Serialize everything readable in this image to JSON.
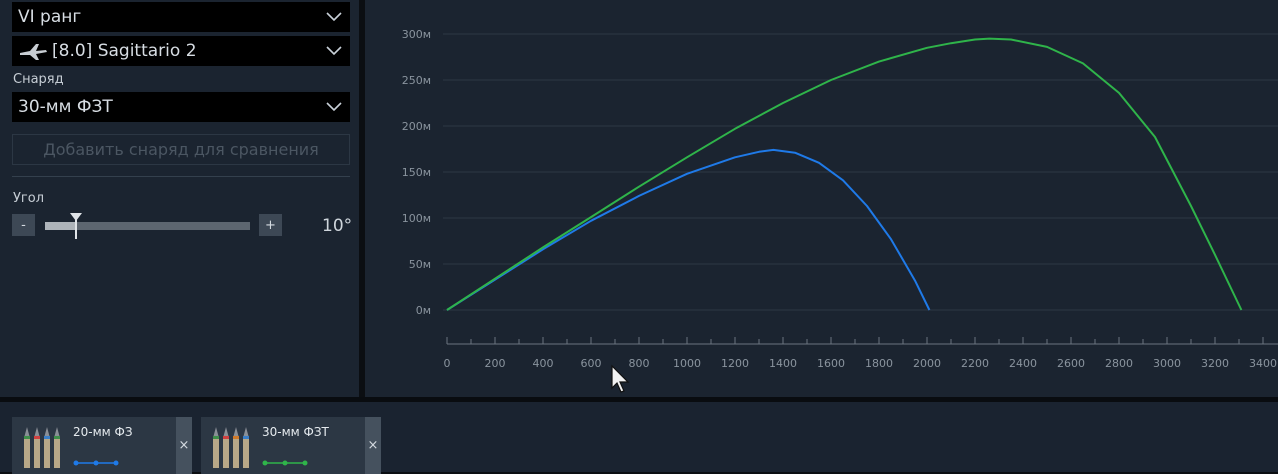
{
  "left": {
    "rank_select": "VI ранг",
    "vehicle_select": "[8.0] Sagittario 2",
    "shell_label": "Снаряд",
    "shell_select": "30-мм ФЗТ",
    "add_shell_button": "Добавить снаряд для сравнения",
    "angle_label": "Угол",
    "minus": "-",
    "plus": "+",
    "angle_value": "10°",
    "angle_slider_fraction": 0.15
  },
  "chart_data": {
    "type": "line",
    "title": "",
    "xlabel": "",
    "ylabel": "",
    "xlim": [
      0,
      3400
    ],
    "ylim": [
      0,
      300
    ],
    "x_ticks": [
      "0",
      "200",
      "400",
      "600",
      "800",
      "1000",
      "1200",
      "1400",
      "1600",
      "1800",
      "2000",
      "2200",
      "2400",
      "2600",
      "2800",
      "3000",
      "3200",
      "3400"
    ],
    "y_ticks": [
      "0м",
      "50м",
      "100м",
      "150м",
      "200м",
      "250м",
      "300м"
    ],
    "grid": true,
    "series": [
      {
        "color": "#1f7ae8",
        "x": [
          0,
          200,
          400,
          600,
          800,
          1000,
          1200,
          1300,
          1360,
          1450,
          1550,
          1650,
          1750,
          1850,
          1950,
          2010
        ],
        "y": [
          0,
          33,
          66,
          97,
          124,
          148,
          166,
          172,
          174,
          171,
          160,
          141,
          113,
          77,
          32,
          0
        ]
      },
      {
        "color": "#2fb44a",
        "x": [
          0,
          200,
          400,
          600,
          800,
          1000,
          1200,
          1400,
          1600,
          1800,
          2000,
          2100,
          2200,
          2260,
          2350,
          2500,
          2650,
          2800,
          2950,
          3100,
          3200,
          3310
        ],
        "y": [
          0,
          34,
          68,
          101,
          134,
          166,
          197,
          225,
          250,
          270,
          285,
          290,
          294,
          295,
          294,
          286,
          268,
          236,
          188,
          113,
          60,
          0
        ]
      }
    ]
  },
  "compare": [
    {
      "name": "20-мм ФЗ",
      "color": "#1f7ae8",
      "close": "×"
    },
    {
      "name": "30-мм ФЗТ",
      "color": "#2fb44a",
      "close": "×"
    }
  ]
}
